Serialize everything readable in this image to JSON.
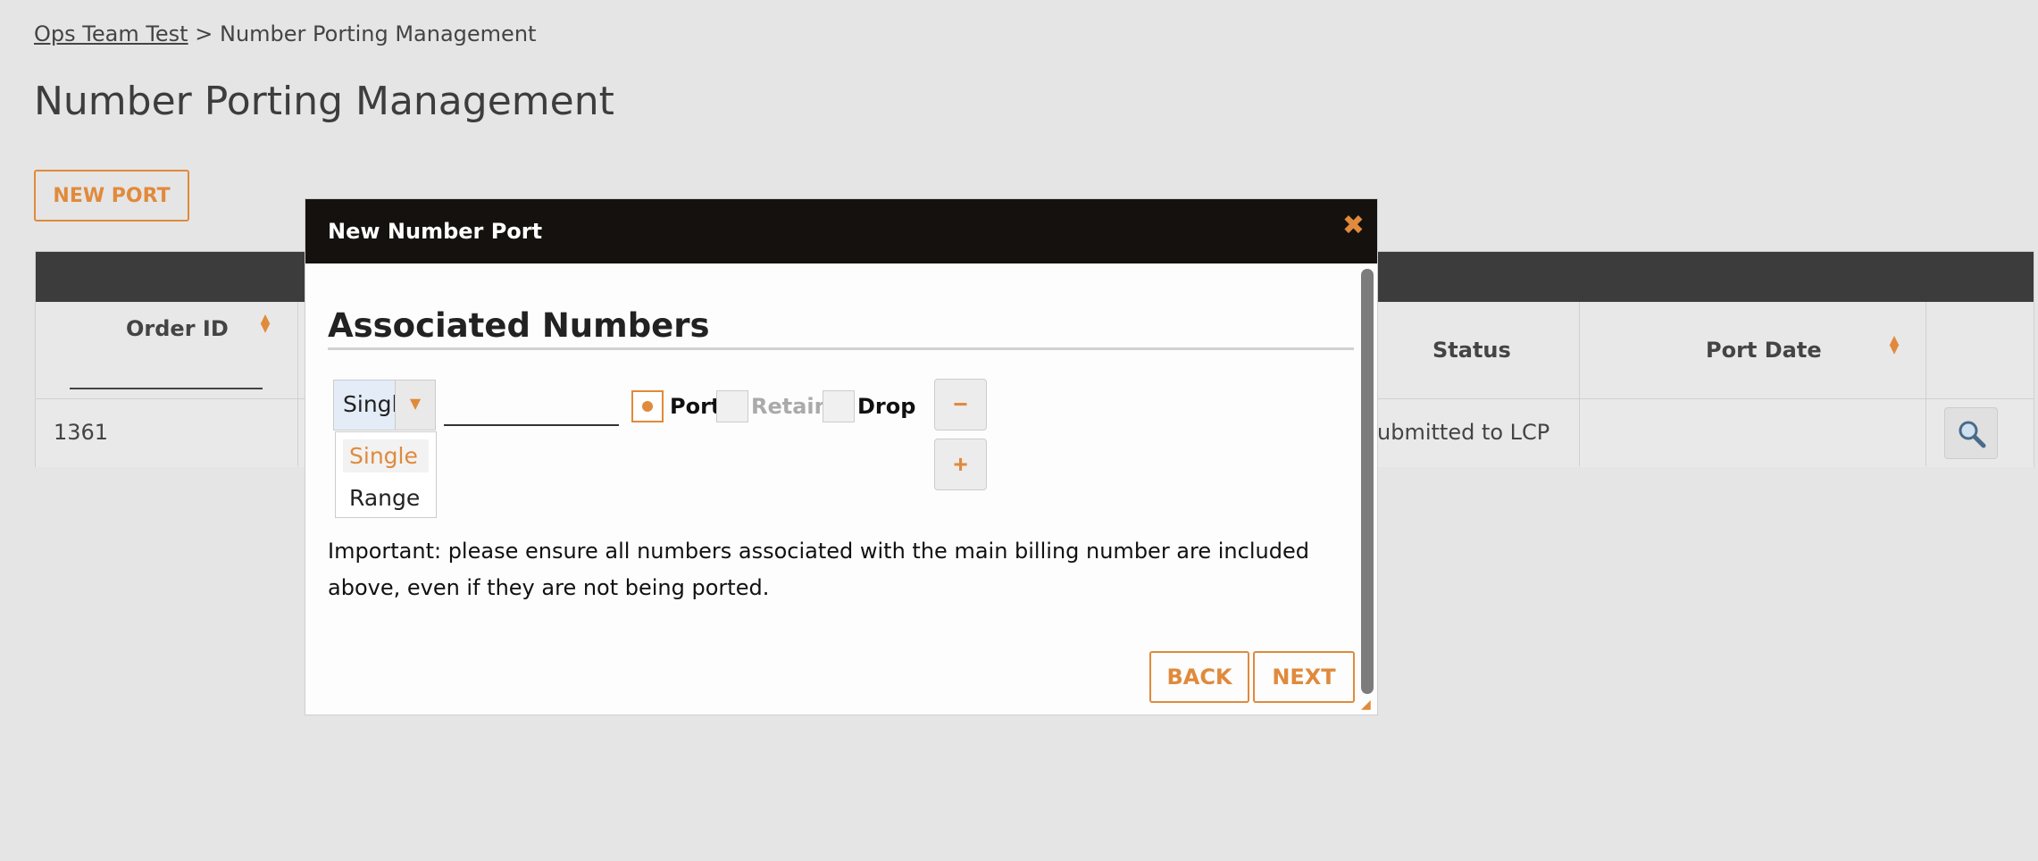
{
  "breadcrumb": {
    "parent": "Ops Team Test",
    "separator": ">",
    "current": "Number Porting Management"
  },
  "page_title": "Number Porting Management",
  "new_port_button": "NEW PORT",
  "grid": {
    "columns": [
      "Order ID",
      "Status",
      "Port Date"
    ],
    "rows": [
      {
        "order_id": "1361",
        "status": "ubmitted to LCP",
        "port_date": ""
      }
    ]
  },
  "modal": {
    "title": "New Number Port",
    "close_glyph": "✖",
    "section_title": "Associated Numbers",
    "type_select": {
      "value": "Single",
      "options": [
        "Single",
        "Range"
      ]
    },
    "number_input": {
      "value": ""
    },
    "options": {
      "port_label": "Port",
      "retain_label": "Retain",
      "drop_label": "Drop",
      "port_checked": true,
      "retain_checked": false,
      "drop_checked": false
    },
    "remove_glyph": "−",
    "add_glyph": "+",
    "note": "Important: please ensure all numbers associated with the main billing number are included above, even if they are not being ported.",
    "back_button": "BACK",
    "next_button": "NEXT"
  },
  "colors": {
    "accent": "#e08a3c",
    "titlebar": "#15110e",
    "background": "#e6e5e5"
  }
}
